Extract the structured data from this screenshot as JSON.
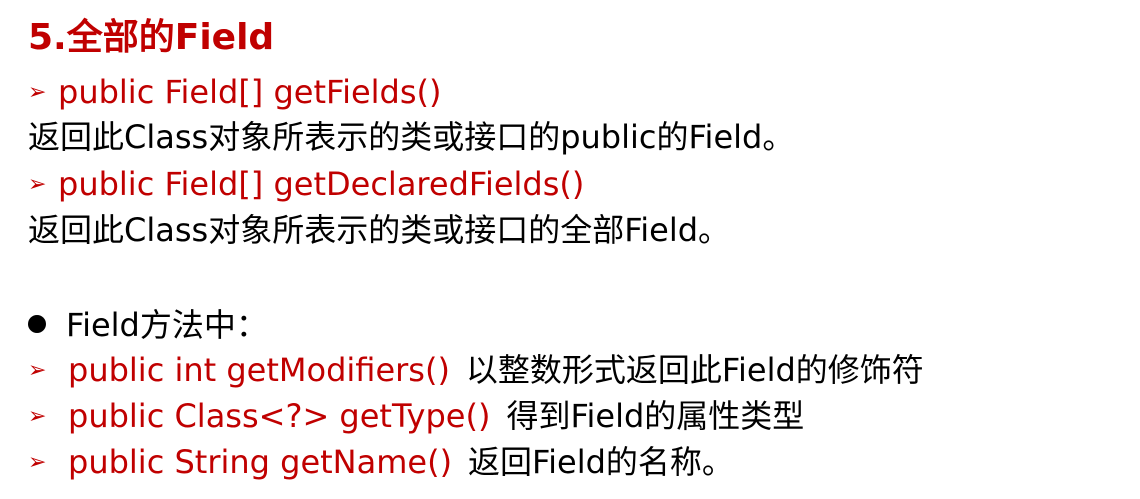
{
  "title": "5.全部的Field",
  "colors": {
    "accent": "#c00000",
    "text": "#000000",
    "background": "#ffffff"
  },
  "section1": {
    "items": [
      {
        "marker": "➢",
        "signature": "public Field[] getFields()",
        "description": "返回此Class对象所表示的类或接口的public的Field。"
      },
      {
        "marker": "➢",
        "signature": "public Field[] getDeclaredFields()",
        "description": "返回此Class对象所表示的类或接口的全部Field。"
      }
    ]
  },
  "section2": {
    "heading": "Field方法中：",
    "items": [
      {
        "marker": "➢",
        "signature": "public int getModifiers()",
        "description": "以整数形式返回此Field的修饰符"
      },
      {
        "marker": "➢",
        "signature": "public Class<?> getType()",
        "description": "得到Field的属性类型"
      },
      {
        "marker": "➢",
        "signature": "public String getName()",
        "description": "返回Field的名称。"
      }
    ]
  }
}
